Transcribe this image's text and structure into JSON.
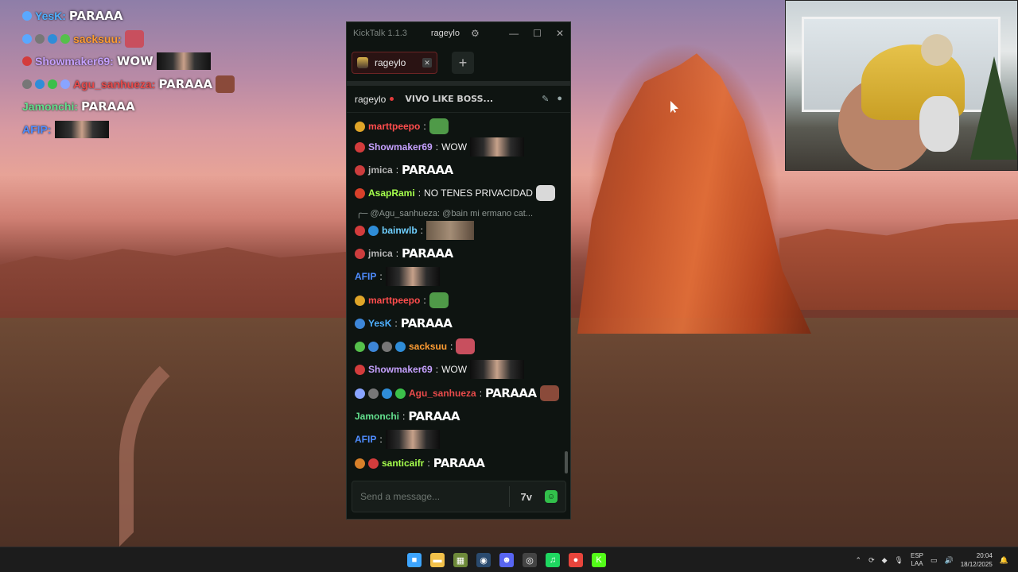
{
  "overlay": {
    "lines": [
      {
        "name": "YesK",
        "name_color": "#4fb0ff",
        "msg": "PARAAA",
        "badges": [
          "#5aa8ff"
        ]
      },
      {
        "name": "sacksuu",
        "name_color": "#ff9d33",
        "msg": "",
        "badges": [
          "#5aa8ff",
          "#777777",
          "#2f8dd8",
          "#55c04b"
        ],
        "emote": "#c84f5e"
      },
      {
        "name": "Showmaker69",
        "name_color": "#c6a1ff",
        "msg": "WOW",
        "badges": [
          "#d33c3c"
        ],
        "image": true
      },
      {
        "name": "Agu_sanhueza",
        "name_color": "#e94b4b",
        "msg": "PARAAA",
        "badges": [
          "#777777",
          "#2f8dd8",
          "#3bbf4a",
          "#89a4ff"
        ],
        "emote": "#8a4a3a"
      },
      {
        "name": "Jamonchi",
        "name_color": "#63e08e",
        "msg": "PARAAA",
        "badges": []
      },
      {
        "name": "AFIP",
        "name_color": "#4f8dff",
        "msg": "",
        "badges": [],
        "image": true
      }
    ]
  },
  "app": {
    "title": "KickTalk 1.1.3",
    "user": "rageylo",
    "window_buttons": {
      "minimize": "—",
      "maximize": "☐",
      "close": "✕"
    },
    "tabs": [
      {
        "label": "rageylo",
        "close": "✕"
      }
    ],
    "add_tab": "+",
    "channel": {
      "name": "rageylo",
      "stream_title": "VIVO LIKE BOSS..."
    },
    "messages": [
      {
        "user": "marttpeepo",
        "color": "#ff4d4d",
        "badges": [
          "#e0a528"
        ],
        "text": "",
        "emote": "#4f9a48"
      },
      {
        "user": "Showmaker69",
        "color": "#c6a1ff",
        "badges": [
          "#d33c3c"
        ],
        "text": "WOW",
        "image": "face"
      },
      {
        "user": "jmica",
        "color": "#b7b7b7",
        "badges": [
          "#cc3d3d"
        ],
        "big": "PARAAA"
      },
      {
        "user": "AsapRami",
        "color": "#a6ff4d",
        "badges": [
          "#d8402a"
        ],
        "text": "NO TENES PRIVACIDAD",
        "emote": "#d9d9d9"
      },
      {
        "reply": "@Agu_sanhueza: @bain mi ermano cat..."
      },
      {
        "user": "bainwlb",
        "color": "#6fd0ff",
        "badges": [
          "#d33c3c",
          "#2f8dd8"
        ],
        "text": "",
        "image": "cat"
      },
      {
        "user": "jmica",
        "color": "#b7b7b7",
        "badges": [
          "#cc3d3d"
        ],
        "big": "PARAAA"
      },
      {
        "user": "AFIP",
        "color": "#4f8dff",
        "badges": [],
        "image": "face"
      },
      {
        "user": "marttpeepo",
        "color": "#ff4d4d",
        "badges": [
          "#e0a528"
        ],
        "text": "",
        "emote": "#4f9a48"
      },
      {
        "user": "YesK",
        "color": "#4fb0ff",
        "badges": [
          "#3d86d8"
        ],
        "big": "PARAAA"
      },
      {
        "user": "sacksuu",
        "color": "#ff9d33",
        "badges": [
          "#55c04b",
          "#3d86d8",
          "#777777",
          "#2f8dd8"
        ],
        "text": "",
        "emote": "#c84f5e"
      },
      {
        "user": "Showmaker69",
        "color": "#c6a1ff",
        "badges": [
          "#d33c3c"
        ],
        "text": "WOW",
        "image": "face"
      },
      {
        "user": "Agu_sanhueza",
        "color": "#e94b4b",
        "badges": [
          "#89a4ff",
          "#777777",
          "#2f8dd8",
          "#3bbf4a"
        ],
        "big": "PARAAA",
        "emote": "#8a4a3a"
      },
      {
        "user": "Jamonchi",
        "color": "#63e08e",
        "badges": [],
        "big": "PARAAA"
      },
      {
        "user": "AFIP",
        "color": "#4f8dff",
        "badges": [],
        "image": "face"
      },
      {
        "user": "santicaifr",
        "color": "#a6ff4d",
        "badges": [
          "#d8802a",
          "#d33c3c"
        ],
        "big": "PARAAA"
      }
    ],
    "composer": {
      "placeholder": "Send a message..."
    }
  },
  "taskbar": {
    "apps": [
      {
        "name": "windows-start",
        "color": "#3da5ff",
        "glyph": "■"
      },
      {
        "name": "file-explorer",
        "color": "#f2c14a",
        "glyph": "▬"
      },
      {
        "name": "app-green",
        "color": "#6e8a3a",
        "glyph": "▦"
      },
      {
        "name": "steam",
        "color": "#2a4a6e",
        "glyph": "◉"
      },
      {
        "name": "discord",
        "color": "#5865f2",
        "glyph": "☻"
      },
      {
        "name": "obs",
        "color": "#444444",
        "glyph": "◎"
      },
      {
        "name": "spotify",
        "color": "#1ed760",
        "glyph": "♫"
      },
      {
        "name": "chrome",
        "color": "#e8453c",
        "glyph": "●"
      },
      {
        "name": "kick",
        "color": "#53fc18",
        "glyph": "K"
      }
    ],
    "lang": [
      "ESP",
      "LAA"
    ],
    "time": "20:04",
    "date": "18/12/2025"
  }
}
